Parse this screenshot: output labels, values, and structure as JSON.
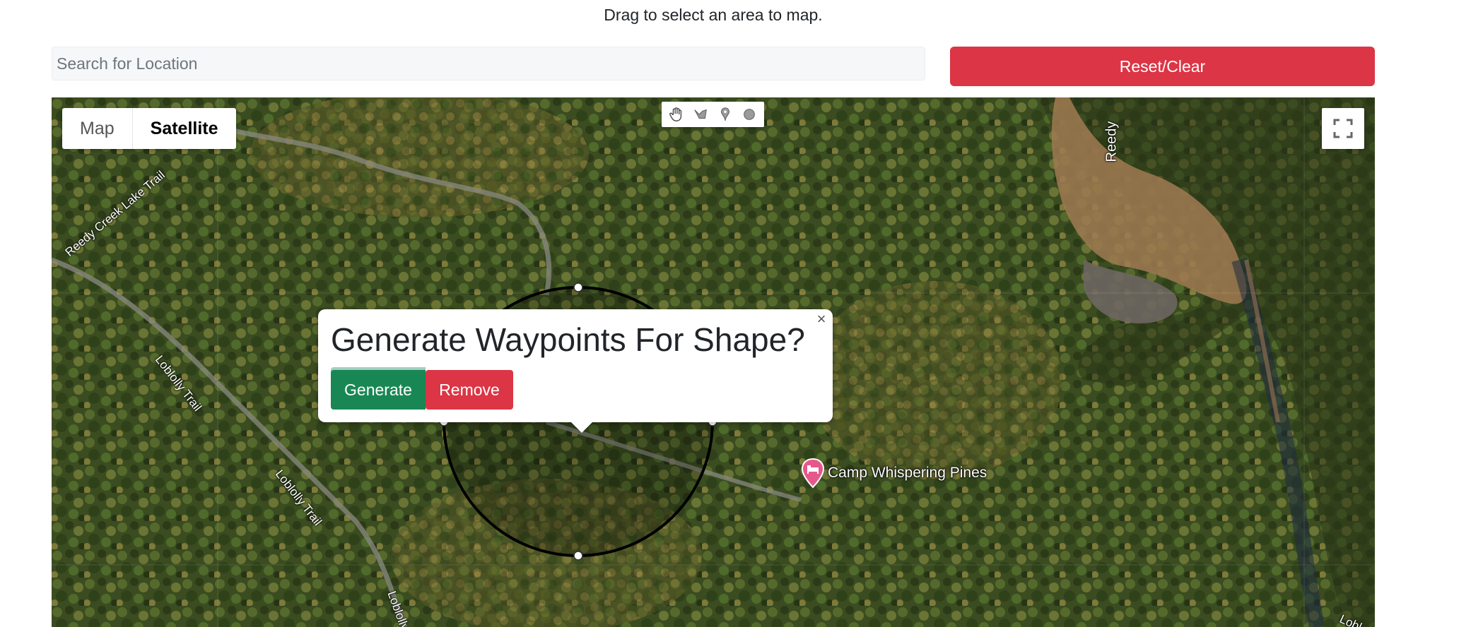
{
  "header": {
    "instruction": "Drag to select an area to map."
  },
  "search": {
    "placeholder": "Search for Location",
    "value": ""
  },
  "reset_button": {
    "label": "Reset/Clear"
  },
  "map": {
    "map_type": {
      "options": [
        "Map",
        "Satellite"
      ],
      "selected": "Satellite"
    },
    "drawing_tools": [
      "hand-icon",
      "polyline-icon",
      "marker-icon",
      "circle-icon"
    ],
    "fullscreen_icon": "fullscreen-icon",
    "labels": {
      "reedy_creek_lake_trail": "Reedy Creek Lake Trail",
      "loblolly_trail_1": "Loblolly Trail",
      "loblolly_trail_2": "Loblolly Trail",
      "loblolly_trail_3": "Loblolly",
      "reedy": "Reedy",
      "lobl": "Lobl"
    },
    "poi": {
      "label": "Camp Whispering Pines",
      "icon": "lodging-pin-icon",
      "color": "#e8578b"
    }
  },
  "popup": {
    "title": "Generate Waypoints For Shape?",
    "generate_label": "Generate",
    "remove_label": "Remove",
    "close_symbol": "×"
  },
  "colors": {
    "danger": "#dc3545",
    "success": "#198754"
  }
}
